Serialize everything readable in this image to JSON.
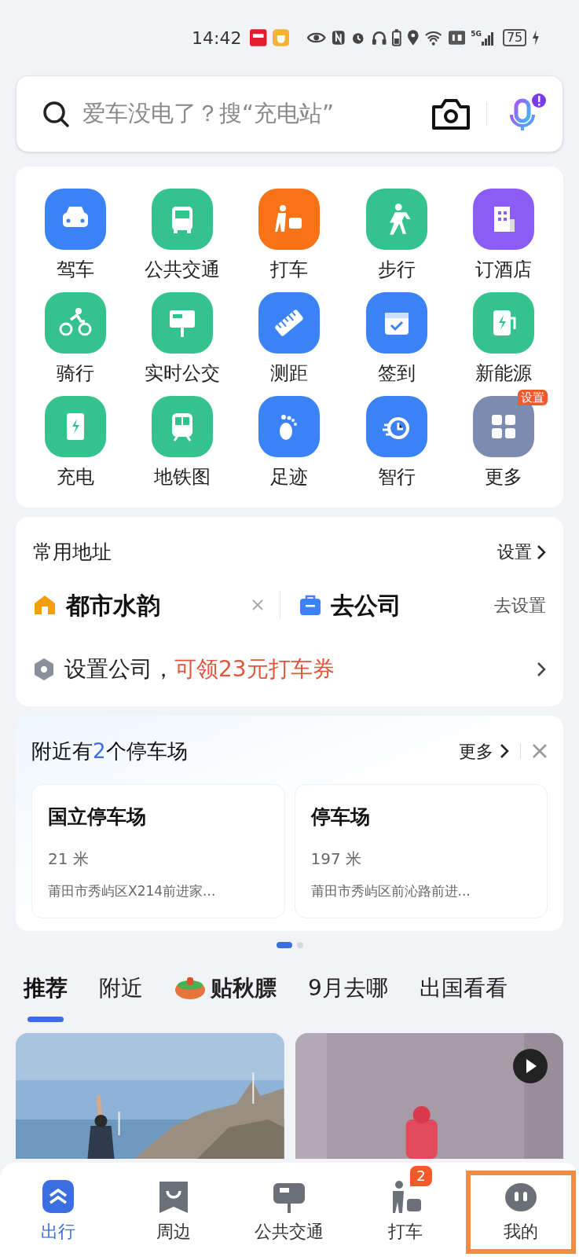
{
  "status_bar": {
    "time": "14:42",
    "network": "5G",
    "battery": "75"
  },
  "search": {
    "placeholder": "爱车没电了？搜“充电站”"
  },
  "shortcuts": [
    {
      "label": "驾车",
      "color": "#3b82f6"
    },
    {
      "label": "公共交通",
      "color": "#34c38f"
    },
    {
      "label": "打车",
      "color": "#f97316"
    },
    {
      "label": "步行",
      "color": "#34c38f"
    },
    {
      "label": "订酒店",
      "color": "#8b5cf6"
    },
    {
      "label": "骑行",
      "color": "#34c38f"
    },
    {
      "label": "实时公交",
      "color": "#34c38f"
    },
    {
      "label": "测距",
      "color": "#3b82f6"
    },
    {
      "label": "签到",
      "color": "#3b82f6"
    },
    {
      "label": "新能源",
      "color": "#34c38f"
    },
    {
      "label": "充电",
      "color": "#34c38f"
    },
    {
      "label": "地铁图",
      "color": "#34c38f"
    },
    {
      "label": "足迹",
      "color": "#3b82f6"
    },
    {
      "label": "智行",
      "color": "#3b82f6"
    },
    {
      "label": "更多",
      "color": "#7d8bb0",
      "badge": "设置"
    }
  ],
  "addresses": {
    "title": "常用地址",
    "settings": "设置",
    "home": {
      "name": "都市水韵"
    },
    "work": {
      "name": "去公司",
      "action": "去设置"
    },
    "promo": {
      "text": "设置公司，",
      "highlight": "可领23元打车券"
    }
  },
  "parking": {
    "title_prefix": "附近有",
    "count": "2",
    "title_suffix": "个停车场",
    "more": "更多",
    "lots": [
      {
        "name": "国立停车场",
        "distance": "21 米",
        "address": "莆田市秀屿区X214前进家..."
      },
      {
        "name": "停车场",
        "distance": "197 米",
        "address": "莆田市秀屿区前沁路前进..."
      }
    ],
    "page_dots": [
      {
        "selected": true
      },
      {
        "selected": false
      }
    ]
  },
  "feed_tabs": [
    {
      "label": "推荐",
      "selected": true,
      "kind": "plain"
    },
    {
      "label": "附近",
      "selected": false,
      "kind": "plain"
    },
    {
      "label": "贴秋膘",
      "selected": false,
      "kind": "promo"
    },
    {
      "label": "9月去哪",
      "selected": false,
      "kind": "plain"
    },
    {
      "label": "出国看看",
      "selected": false,
      "kind": "plain"
    }
  ],
  "feed": [
    {
      "kind": "picture"
    },
    {
      "kind": "video"
    }
  ],
  "bottom_nav": [
    {
      "label": "出行",
      "selected": true,
      "highlighted": false
    },
    {
      "label": "周边",
      "selected": false,
      "highlighted": false
    },
    {
      "label": "公共交通",
      "selected": false,
      "highlighted": false
    },
    {
      "label": "打车",
      "selected": false,
      "highlighted": false,
      "badge": "2"
    },
    {
      "label": "我的",
      "selected": false,
      "highlighted": true
    }
  ]
}
